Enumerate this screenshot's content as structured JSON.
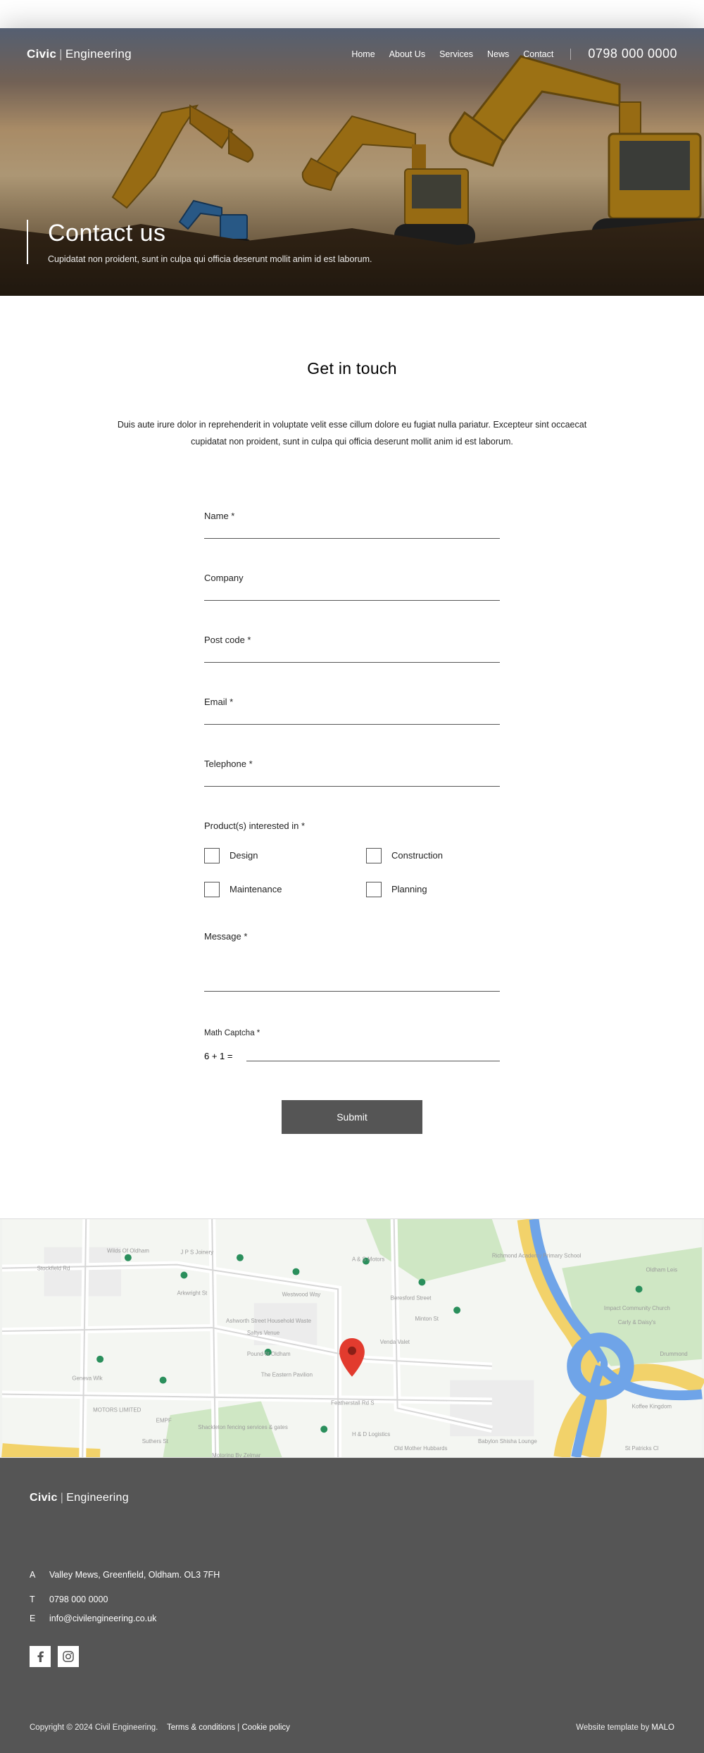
{
  "brand": {
    "bold": "Civic",
    "light": "Engineering"
  },
  "nav": {
    "items": [
      {
        "label": "Home"
      },
      {
        "label": "About Us"
      },
      {
        "label": "Services"
      },
      {
        "label": "News"
      },
      {
        "label": "Contact"
      }
    ],
    "phone": "0798 000 0000"
  },
  "hero": {
    "title": "Contact us",
    "subtitle": "Cupidatat non proident, sunt in culpa qui officia deserunt mollit anim id est laborum."
  },
  "main": {
    "heading": "Get in touch",
    "intro": "Duis aute irure dolor in reprehenderit in voluptate velit esse cillum dolore eu fugiat nulla pariatur. Excepteur sint occaecat cupidatat non proident, sunt in culpa qui officia deserunt mollit anim id est laborum."
  },
  "form": {
    "name": "Name *",
    "company": "Company",
    "postcode": "Post code *",
    "email": "Email *",
    "telephone": "Telephone *",
    "products_label": "Product(s) interested in *",
    "products": [
      {
        "label": "Design"
      },
      {
        "label": "Construction"
      },
      {
        "label": "Maintenance"
      },
      {
        "label": "Planning"
      }
    ],
    "message": "Message *",
    "captcha_label": "Math Captcha *",
    "captcha_question": "6 + 1 =",
    "submit": "Submit"
  },
  "footer": {
    "address_key": "A",
    "address": "Valley Mews, Greenfield, Oldham. OL3 7FH",
    "tel_key": "T",
    "tel": "0798 000 0000",
    "email_key": "E",
    "email": "info@civilengineering.co.uk",
    "copyright": "Copyright © 2024 Civil Engineering.",
    "terms": "Terms & conditions",
    "separator": " | ",
    "cookie": "Cookie policy",
    "credit_prefix": "Website template  by ",
    "credit_link": "MALO"
  }
}
